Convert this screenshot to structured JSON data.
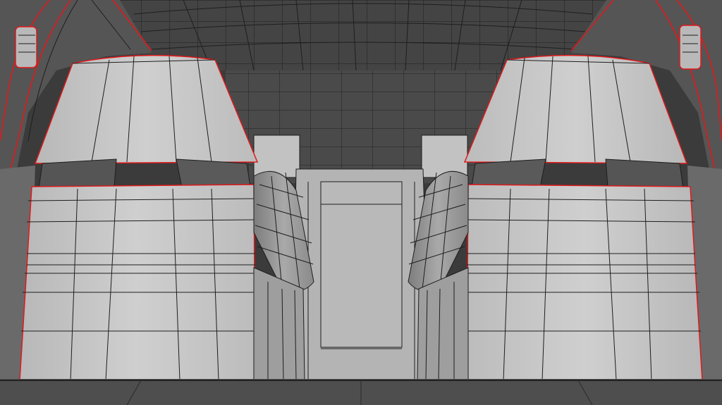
{
  "viewport": {
    "mode": "3d-wireframe-over-solid",
    "subject": "car-interior-rear-seats",
    "colors": {
      "background": "#3b3b3b",
      "roof": "#454545",
      "back_wall": "#4a4a4a",
      "seat_light": "#c9c9c9",
      "seat_mid": "#b5b5b5",
      "seat_shadow": "#8f8f8f",
      "armrest": "#9a9a9a",
      "console": "#b0b0b0",
      "floor": "#4e4e4e",
      "wire": "#1c1c1c",
      "seam": "#e0191b"
    }
  }
}
